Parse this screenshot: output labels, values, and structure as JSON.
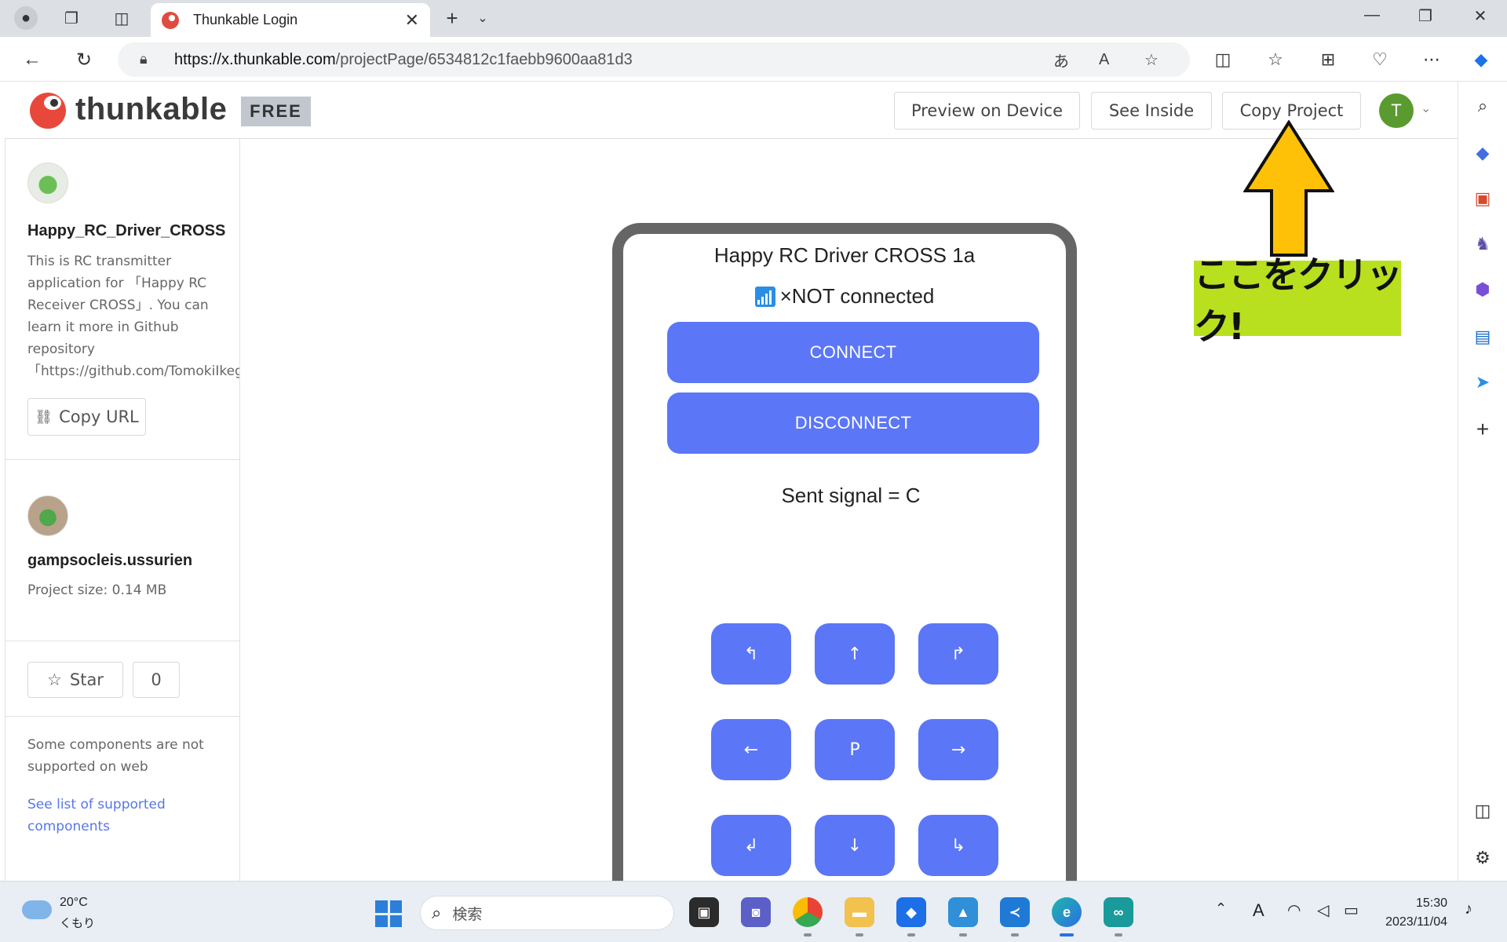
{
  "browser": {
    "tab_title": "Thunkable Login",
    "url_host": "https://x.thunkable.com",
    "url_path": "/projectPage/6534812c1faebb9600aa81d3"
  },
  "header": {
    "logo_text": "thunkable",
    "plan_badge": "FREE",
    "preview_label": "Preview on Device",
    "see_inside_label": "See Inside",
    "copy_project_label": "Copy Project",
    "avatar_initial": "T"
  },
  "sidebar": {
    "project_name": "Happy_RC_Driver_CROSS",
    "description": "This is RC transmitter\napplication for 「Happy RC\nReceiver CROSS」. You can\nlearn it more in Github\nrepository\n「https://github.com/TomokiIkegami",
    "copy_url_label": "Copy URL",
    "author_name": "gampsocleis.ussurien",
    "project_size": "Project size: 0.14 MB",
    "star_label": "Star",
    "star_count": "0",
    "web_note": "Some components are not supported on web",
    "supported_link": "See list of supported components"
  },
  "app": {
    "title": "Happy RC Driver CROSS 1a",
    "status": "×NOT connected",
    "connect_label": "CONNECT",
    "disconnect_label": "DISCONNECT",
    "signal_text": "Sent signal = C",
    "dpad": [
      "↰",
      "↑",
      "↱",
      "←",
      "P",
      "→",
      "↲",
      "↓",
      "↳"
    ]
  },
  "annotation": {
    "callout_text": "ここをクリック!",
    "arrow_color": "#ffc107",
    "callout_color": "#b8e01e"
  },
  "taskbar": {
    "temperature": "20°C",
    "weather": "くもり",
    "search_placeholder": "検索",
    "time": "15:30",
    "date": "2023/11/04"
  },
  "colors": {
    "accent_button": "#5b76f7",
    "phone_frame": "#666666",
    "link": "#5677e8"
  }
}
